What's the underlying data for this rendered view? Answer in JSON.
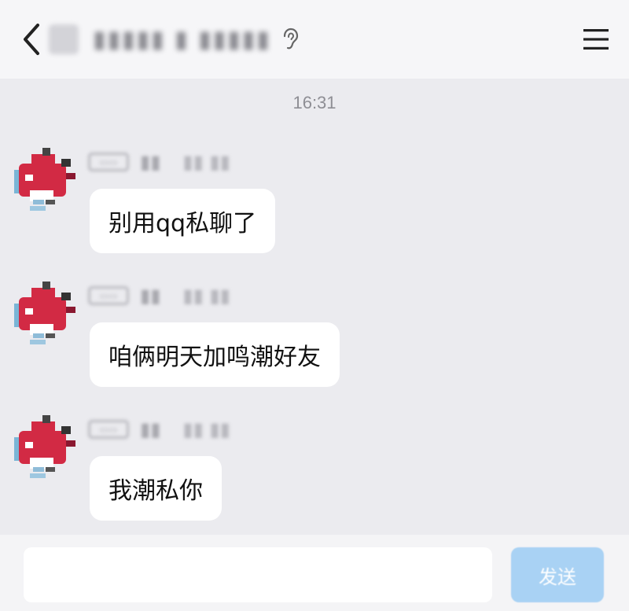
{
  "header": {
    "back_icon": "chevron-left-icon",
    "title": "▮▮▮▮▮ ▮ ▮▮▮▮▮",
    "voice_icon": "ear-icon",
    "menu_icon": "menu-icon"
  },
  "chat": {
    "timestamp": "16:31",
    "sender": {
      "tag": "▭▭",
      "name": "▮▮",
      "extra": "▮▮ ▮▮"
    },
    "messages": [
      {
        "text": "别用qq私聊了"
      },
      {
        "text": "咱俩明天加鸣潮好友"
      },
      {
        "text": "我潮私你"
      }
    ]
  },
  "composer": {
    "input_value": "",
    "send_label": "发送"
  },
  "colors": {
    "background": "#ebebef",
    "bubble": "#ffffff",
    "send_button": "#a9d2f4",
    "avatar_red": "#d22a44"
  }
}
